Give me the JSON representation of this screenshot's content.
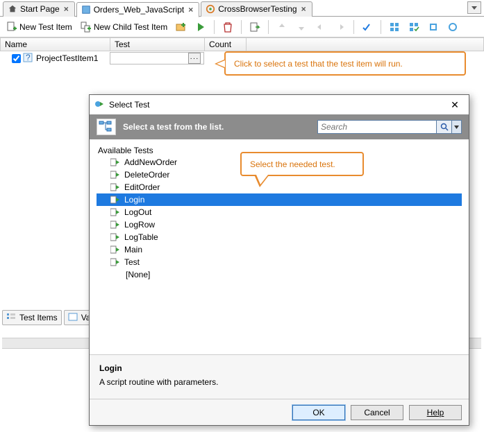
{
  "tabs": [
    {
      "label": "Start Page",
      "icon": "home-icon",
      "active": false
    },
    {
      "label": "Orders_Web_JavaScript",
      "icon": "script-icon",
      "active": true
    },
    {
      "label": "CrossBrowserTesting",
      "icon": "cbt-icon",
      "active": false
    }
  ],
  "toolbar": {
    "new_test_item": "New Test Item",
    "new_child_test_item": "New Child Test Item"
  },
  "grid": {
    "headers": {
      "name": "Name",
      "test": "Test",
      "count": "Count"
    },
    "rows": [
      {
        "checked": true,
        "name": "ProjectTestItem1",
        "test": "",
        "count": ""
      }
    ]
  },
  "bottom_tabs": [
    {
      "label": "Test Items",
      "icon": "list-icon"
    },
    {
      "label": "Va",
      "icon": "var-icon"
    }
  ],
  "callouts": {
    "c1": "Click to select a test that the test item will run.",
    "c2": "Select the needed test."
  },
  "dialog": {
    "title": "Select Test",
    "band_text": "Select a test from the list.",
    "search_placeholder": "Search",
    "available_label": "Available Tests",
    "tests": [
      "AddNewOrder",
      "DeleteOrder",
      "EditOrder",
      "Login",
      "LogOut",
      "LogRow",
      "LogTable",
      "Main",
      "Test"
    ],
    "none_label": "[None]",
    "selected_index": 3,
    "detail": {
      "title": "Login",
      "desc": "A script routine with parameters."
    },
    "buttons": {
      "ok": "OK",
      "cancel": "Cancel",
      "help": "Help"
    }
  }
}
